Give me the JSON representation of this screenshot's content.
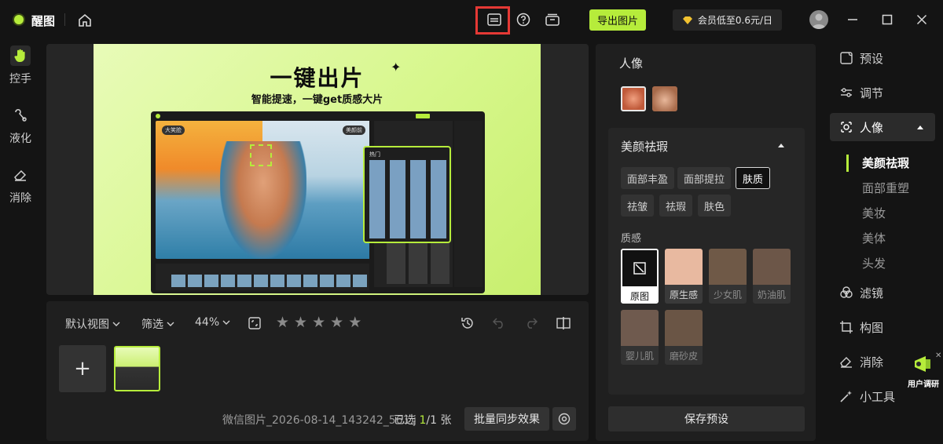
{
  "app": {
    "title": "醒图"
  },
  "titlebar": {
    "export_label": "导出图片",
    "member_label": "会员低至0.6元/日",
    "accent": "#b6ec3b",
    "highlight_color": "#e53935"
  },
  "left_tools": [
    {
      "label": "控手",
      "icon": "hand-icon"
    },
    {
      "label": "液化",
      "icon": "liquify-icon"
    },
    {
      "label": "消除",
      "icon": "eraser-icon"
    }
  ],
  "poster": {
    "title": "一键出片",
    "subtitle": "智能提速，一键get质感大片",
    "badge_left": "大笑脸",
    "badge_right": "美颜前",
    "popup_title": "热门"
  },
  "bottom": {
    "view_label": "默认视图",
    "filter_label": "筛选",
    "zoom_label": "44%",
    "rating_stars": 5,
    "filename": "微信图片_2026-08-14_143242_561.j",
    "selected_prefix": "已选 ",
    "selected_current": "1",
    "selected_suffix": "/1 张",
    "sync_label": "批量同步效果"
  },
  "adjust": {
    "portrait_title": "人像",
    "beauty_title": "美颜祛瑕",
    "chips": [
      "面部丰盈",
      "面部提拉",
      "肤质",
      "祛皱",
      "祛瑕",
      "肤色"
    ],
    "active_chip": "肤质",
    "texture_title": "质感",
    "swatches": [
      {
        "label": "原图",
        "color": "#ffffff"
      },
      {
        "label": "原生感",
        "color": "#e8b9a0"
      },
      {
        "label": "少女肌",
        "color": "#6f5947"
      },
      {
        "label": "奶油肌",
        "color": "#6c5648"
      },
      {
        "label": "婴儿肌",
        "color": "#6f5a4e"
      },
      {
        "label": "磨砂皮",
        "color": "#6a5545"
      }
    ],
    "save_preset_label": "保存预设"
  },
  "right_nav": {
    "items": [
      "预设",
      "调节",
      "人像",
      "滤镜",
      "构图",
      "消除",
      "小工具"
    ],
    "active": "人像",
    "sub_items": [
      "美颜祛瑕",
      "面部重塑",
      "美妆",
      "美体",
      "头发"
    ],
    "active_sub": "美颜祛瑕",
    "survey_label": "用户调研"
  }
}
